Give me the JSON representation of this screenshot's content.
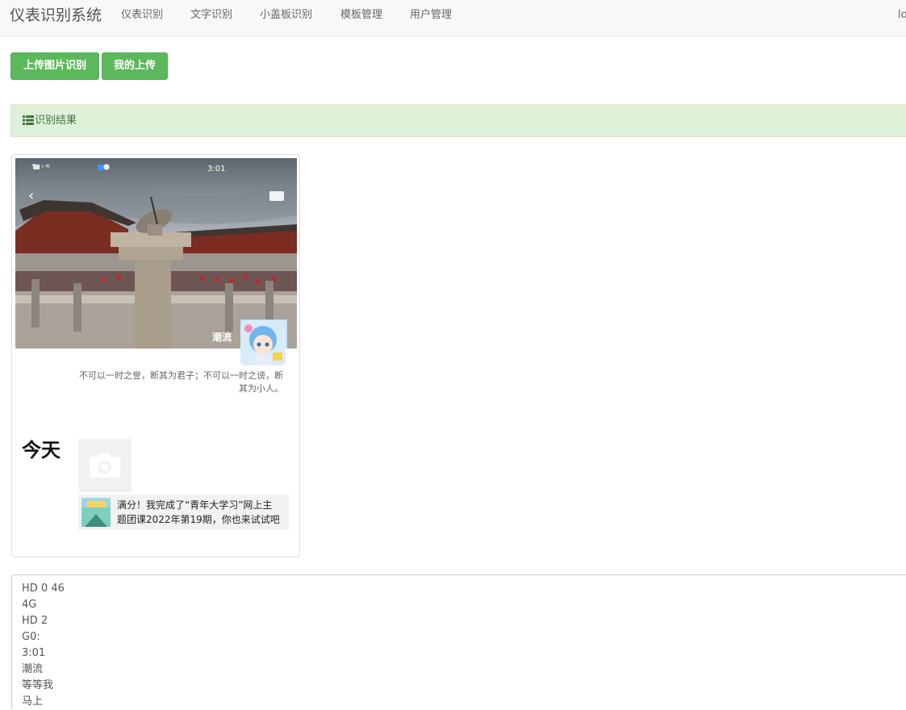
{
  "navbar": {
    "brand": "仪表识别系统",
    "items": [
      {
        "label": "仪表识别"
      },
      {
        "label": "文字识别"
      },
      {
        "label": "小盖板识别"
      },
      {
        "label": "模板管理"
      },
      {
        "label": "用户管理"
      }
    ],
    "right_label": "lo"
  },
  "buttons": {
    "upload": "上传图片识别",
    "my_uploads": "我的上传"
  },
  "panel": {
    "title": "识别结果"
  },
  "image": {
    "status_time": "3:01",
    "overlay_label": "潮流",
    "quote": "不可以一时之誉，断其为君子；不可以一时之谤，断其为小人。",
    "today": "今天",
    "share_text_line1": "满分！我完成了“青年大学习”网上主",
    "share_text_line2": "题团课2022年第19期，你也来试试吧"
  },
  "result": {
    "lines": [
      "HD 0 46",
      "4G",
      "HD 2",
      "G0:",
      "3:01",
      "潮流",
      "等等我",
      "马上"
    ]
  },
  "colors": {
    "success": "#5cb85c",
    "panel_bg": "#dff0d8",
    "panel_text": "#3c763d"
  }
}
